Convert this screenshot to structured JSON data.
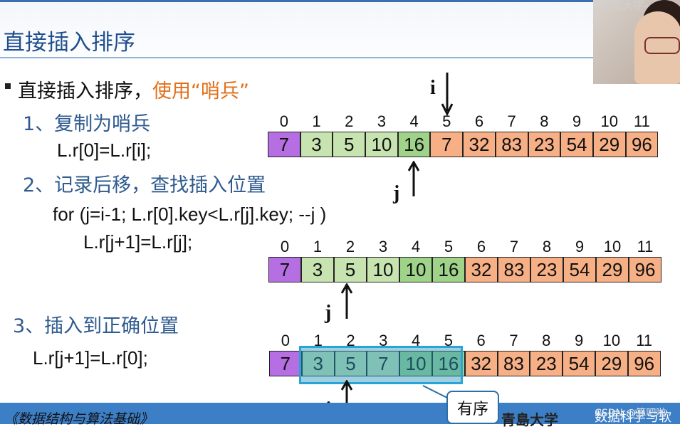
{
  "header": {
    "title": "直接插入排序"
  },
  "webcam": {
    "overlay_text": "青岛大学--王卓"
  },
  "bullet": {
    "prefix": "直接插入排序，",
    "highlight": "使用“哨兵”"
  },
  "steps": {
    "s1": "1、复制为哨兵",
    "c1": "L.r[0]=L.r[i];",
    "s2": "2、记录后移，查找插入位置",
    "c2a": "for (j=i-1; L.r[0].key<L.r[j].key; --j )",
    "c2b": "L.r[j+1]=L.r[j];",
    "s3": "3、插入到正确位置",
    "c3": "L.r[j+1]=L.r[0];"
  },
  "labels": {
    "i": "i",
    "j": "j"
  },
  "indices": [
    "0",
    "1",
    "2",
    "3",
    "4",
    "5",
    "6",
    "7",
    "8",
    "9",
    "10",
    "11"
  ],
  "arrays": [
    {
      "values": [
        "7",
        "3",
        "5",
        "10",
        "16",
        "7",
        "32",
        "83",
        "23",
        "54",
        "29",
        "96"
      ],
      "colors": [
        "purple",
        "lgreen",
        "lgreen",
        "lgreen",
        "mgreen",
        "orange",
        "orange",
        "orange",
        "orange",
        "orange",
        "orange",
        "orange"
      ]
    },
    {
      "values": [
        "7",
        "3",
        "5",
        "10",
        "10",
        "16",
        "32",
        "83",
        "23",
        "54",
        "29",
        "96"
      ],
      "colors": [
        "purple",
        "lgreen",
        "lgreen",
        "lgreen",
        "mgreen",
        "mgreen",
        "orange",
        "orange",
        "orange",
        "orange",
        "orange",
        "orange"
      ]
    },
    {
      "values": [
        "7",
        "3",
        "5",
        "7",
        "10",
        "16",
        "32",
        "83",
        "23",
        "54",
        "29",
        "96"
      ],
      "colors": [
        "purple",
        "lgreen",
        "lgreen",
        "lgreen",
        "mgreen",
        "mgreen",
        "orange",
        "orange",
        "orange",
        "orange",
        "orange",
        "orange"
      ]
    }
  ],
  "callout": "有序",
  "footer": {
    "left": "《数据结构与算法基础》",
    "logo": "青島大学",
    "right": "数据科学与软件",
    "watermark": "CSDN @算吧啦"
  }
}
